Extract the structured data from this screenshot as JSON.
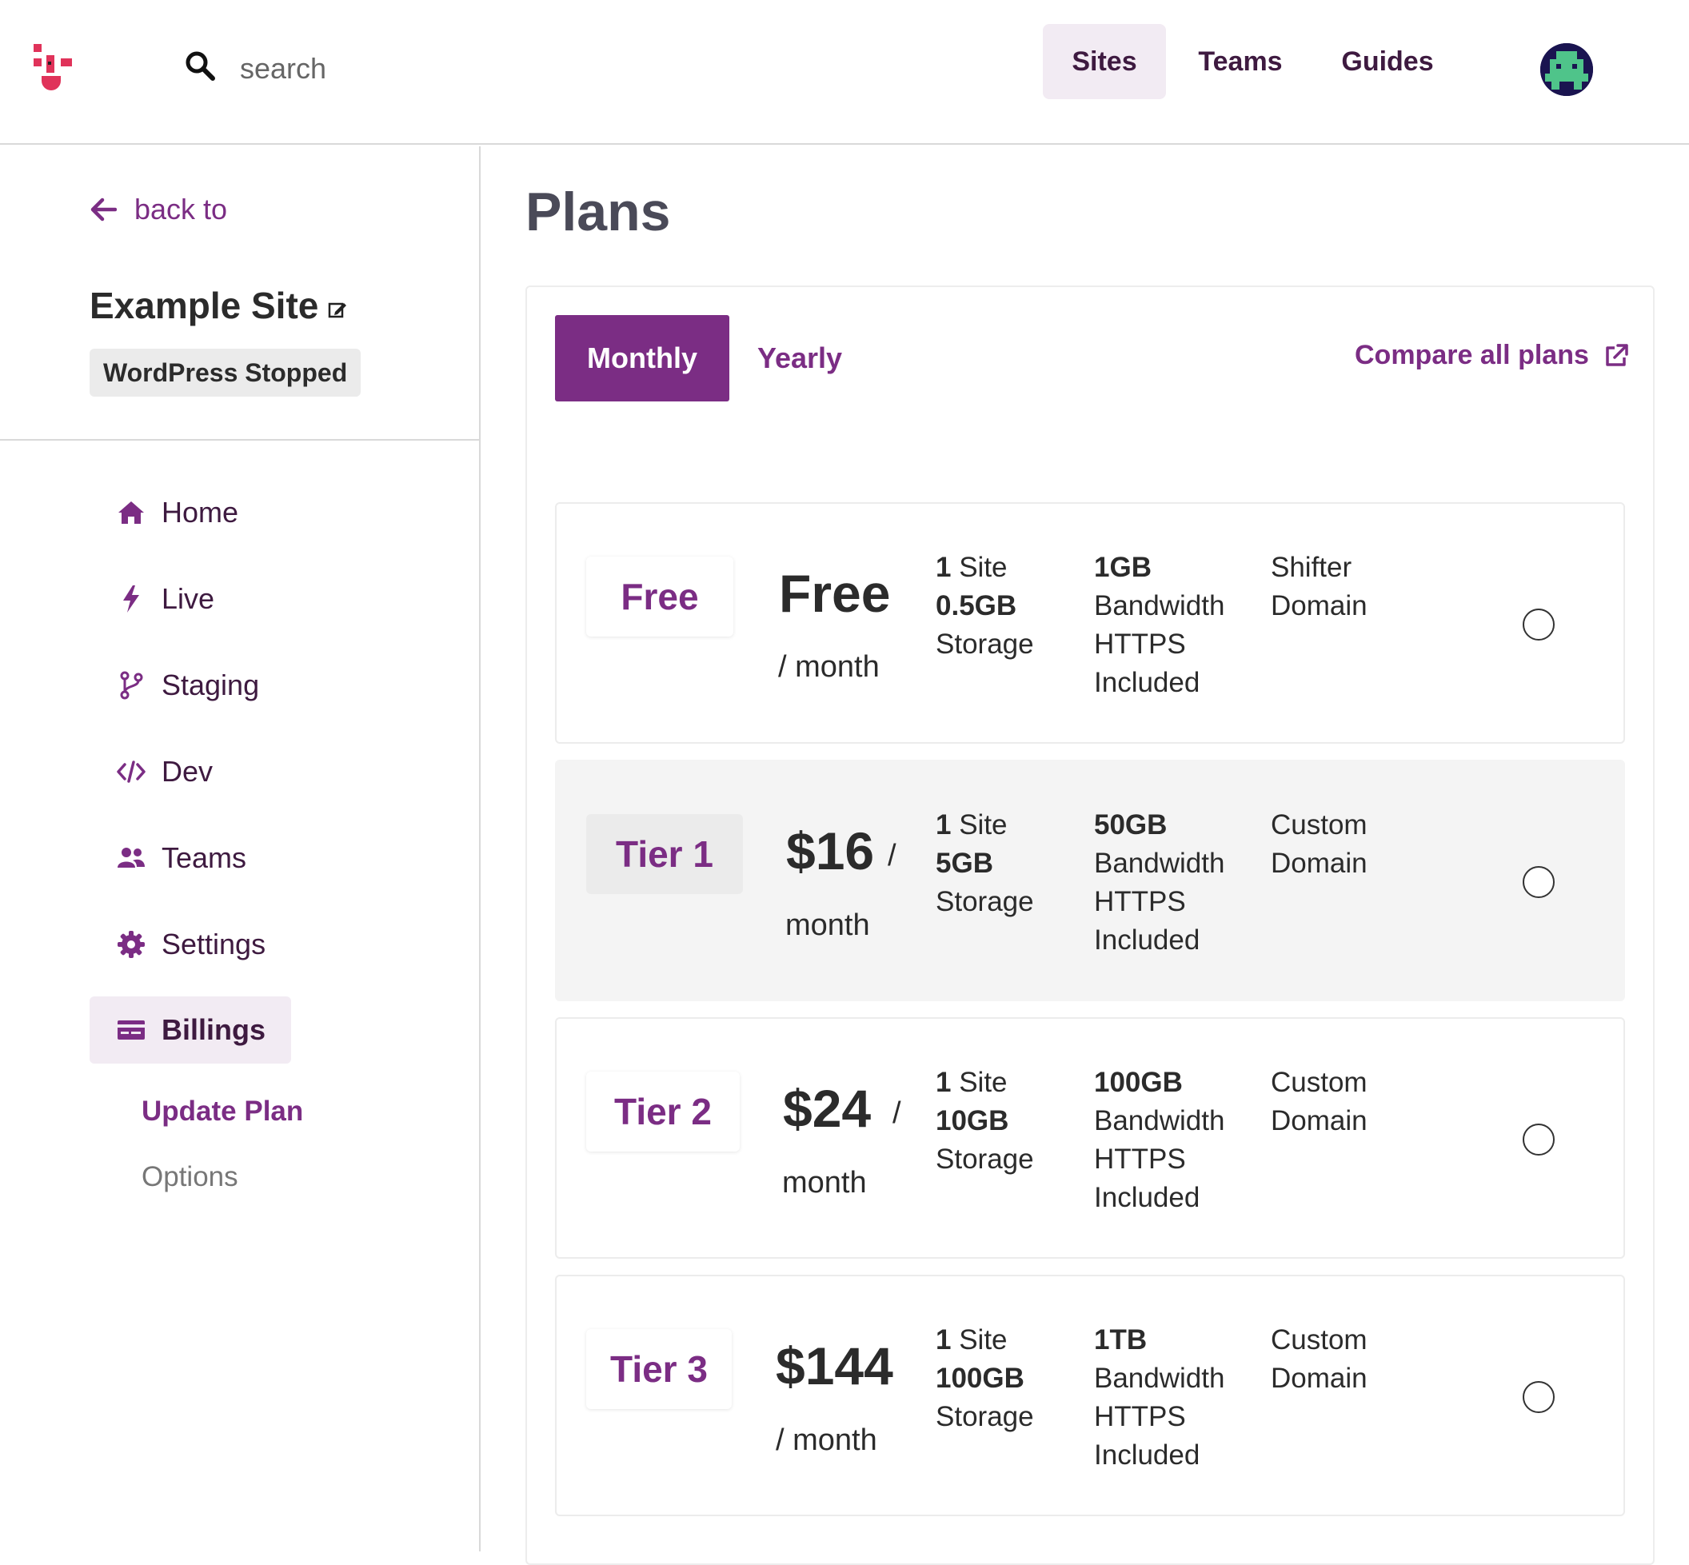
{
  "header": {
    "search_placeholder": "search",
    "nav": [
      "Sites",
      "Teams",
      "Guides"
    ]
  },
  "sidebar": {
    "back_label": "back to",
    "site_title": "Example Site",
    "status": "WordPress Stopped",
    "items": [
      {
        "label": "Home",
        "icon": "home-icon"
      },
      {
        "label": "Live",
        "icon": "bolt-icon"
      },
      {
        "label": "Staging",
        "icon": "branch-icon"
      },
      {
        "label": "Dev",
        "icon": "code-icon"
      },
      {
        "label": "Teams",
        "icon": "users-icon"
      },
      {
        "label": "Settings",
        "icon": "gear-icon"
      },
      {
        "label": "Billings",
        "icon": "billing-icon"
      }
    ],
    "sub_items": [
      "Update Plan",
      "Options"
    ]
  },
  "main": {
    "title": "Plans",
    "tabs": [
      "Monthly",
      "Yearly"
    ],
    "compare_label": "Compare all plans",
    "plans": [
      {
        "name": "Free",
        "price": "Free",
        "per": "/ month",
        "sites": "1",
        "sites_label": "Site",
        "storage": "0.5GB",
        "storage_label": "Storage",
        "bandwidth": "1GB",
        "bandwidth_label": "Bandwidth",
        "https": "HTTPS",
        "https_label": "Included",
        "domain_1": "Shifter",
        "domain_2": "Domain"
      },
      {
        "name": "Tier 1",
        "price": "$16",
        "slash": "/",
        "per": "month",
        "sites": "1",
        "sites_label": "Site",
        "storage": "5GB",
        "storage_label": "Storage",
        "bandwidth": "50GB",
        "bandwidth_label": "Bandwidth",
        "https": "HTTPS",
        "https_label": "Included",
        "domain_1": "Custom",
        "domain_2": "Domain"
      },
      {
        "name": "Tier 2",
        "price": "$24",
        "slash": "/",
        "per": "month",
        "sites": "1",
        "sites_label": "Site",
        "storage": "10GB",
        "storage_label": "Storage",
        "bandwidth": "100GB",
        "bandwidth_label": "Bandwidth",
        "https": "HTTPS",
        "https_label": "Included",
        "domain_1": "Custom",
        "domain_2": "Domain"
      },
      {
        "name": "Tier 3",
        "price": "$144",
        "per": "/ month",
        "sites": "1",
        "sites_label": "Site",
        "storage": "100GB",
        "storage_label": "Storage",
        "bandwidth": "1TB",
        "bandwidth_label": "Bandwidth",
        "https": "HTTPS",
        "https_label": "Included",
        "domain_1": "Custom",
        "domain_2": "Domain"
      }
    ]
  },
  "colors": {
    "accent": "#7b2d84",
    "nav_text": "#3e1a40",
    "active_bg": "#f2ebf3",
    "logo": "#e0335a"
  }
}
